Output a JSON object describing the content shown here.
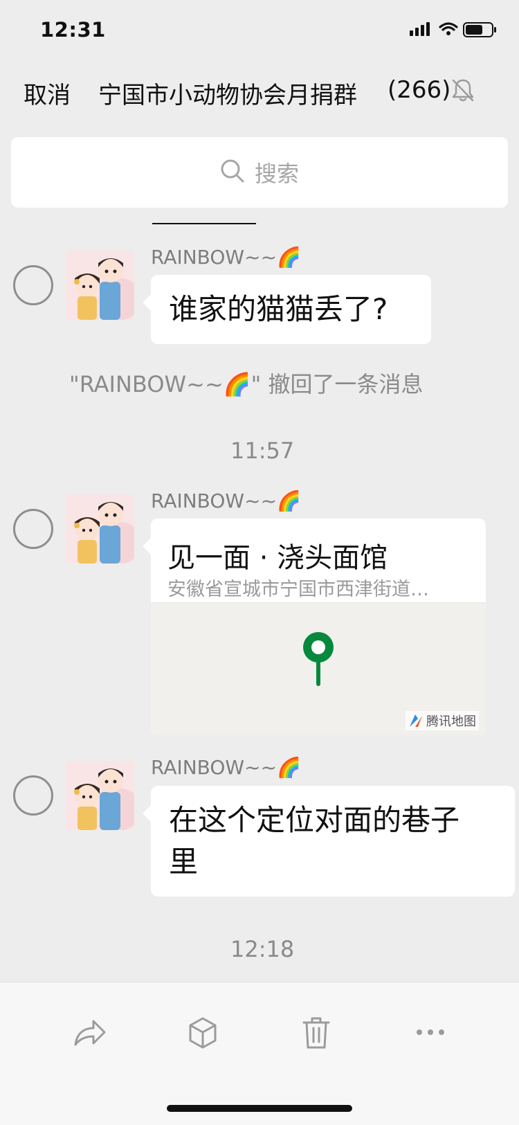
{
  "status_bar": {
    "time": "12:31"
  },
  "header": {
    "cancel_label": "取消",
    "title": "宁国市小动物协会月捐群",
    "member_count": "(266)",
    "mute_icon": "bell-slash-icon"
  },
  "search": {
    "placeholder": "搜索",
    "icon": "search-icon"
  },
  "messages": [
    {
      "type": "text",
      "sender": "RAINBOW~~🌈",
      "text": "谁家的猫猫丢了?"
    },
    {
      "type": "system",
      "text": "\"RAINBOW~~🌈\" 撤回了一条消息"
    },
    {
      "type": "timestamp",
      "text": "11:57"
    },
    {
      "type": "location",
      "sender": "RAINBOW~~🌈",
      "title": "见一面 · 浇头面馆",
      "address": "安徽省宣城市宁国市西津街道…",
      "map_attribution": "腾讯地图",
      "pin_color": "#07893d"
    },
    {
      "type": "text",
      "sender": "RAINBOW~~🌈",
      "text_line1": "在这个定位对面的巷子",
      "text_line2": "里"
    },
    {
      "type": "timestamp",
      "text": "12:18"
    }
  ],
  "toolbar": {
    "buttons": [
      {
        "icon": "forward-icon"
      },
      {
        "icon": "favorite-box-icon"
      },
      {
        "icon": "trash-icon"
      },
      {
        "icon": "more-icon"
      }
    ]
  },
  "colors": {
    "background": "#ededed",
    "bubble": "#ffffff",
    "toolbar_icon": "#9b9b9b"
  }
}
